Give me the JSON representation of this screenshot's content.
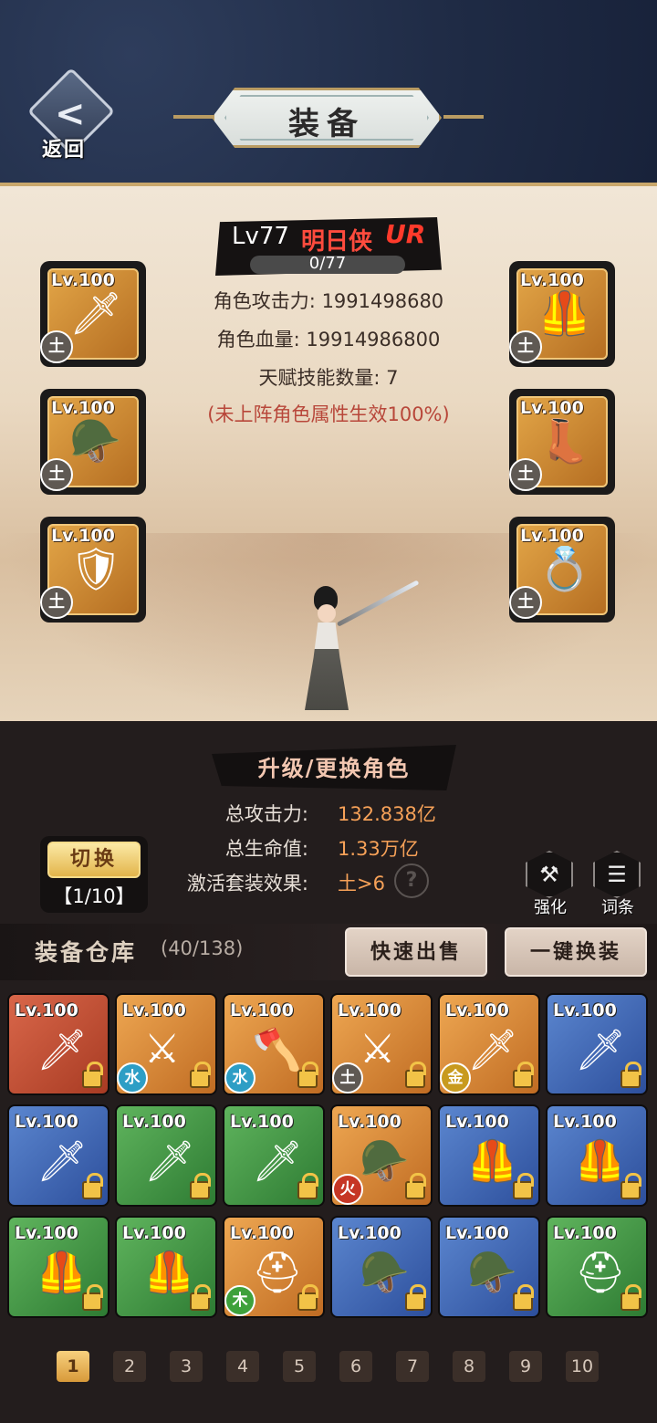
{
  "header": {
    "back_label": "返回",
    "back_glyph": "<",
    "title": "装备"
  },
  "hero": {
    "level": "Lv77",
    "name": "明日侠",
    "rank": "UR",
    "exp": "0/77",
    "attack_line": "角色攻击力: 1991498680",
    "hp_line": "角色血量: 19914986800",
    "talent_line": "天赋技能数量: 7",
    "note_line": "(未上阵角色属性生效100%)"
  },
  "equipped": [
    {
      "level": "Lv.100",
      "element": "土",
      "art": "🗡"
    },
    {
      "level": "Lv.100",
      "element": "土",
      "art": "🪖"
    },
    {
      "level": "Lv.100",
      "element": "土",
      "art": "🛡"
    },
    {
      "level": "Lv.100",
      "element": "土",
      "art": "🦺"
    },
    {
      "level": "Lv.100",
      "element": "土",
      "art": "👢"
    },
    {
      "level": "Lv.100",
      "element": "土",
      "art": "💍"
    }
  ],
  "summary": {
    "upgrade_label": "升级/更换角色",
    "total_attack_label": "总攻击力:",
    "total_attack_value": "132.838亿",
    "total_hp_label": "总生命值:",
    "total_hp_value": "1.33万亿",
    "set_label": "激活套装效果:",
    "set_value": "土>6",
    "help": "?"
  },
  "switch": {
    "label": "切换",
    "page": "【1/10】"
  },
  "side_buttons": {
    "enhance_label": "强化",
    "enhance_icon": "⚒",
    "affix_label": "词条",
    "affix_icon": "☰"
  },
  "warehouse": {
    "title": "装备仓库",
    "count": "(40/138)",
    "quick_sell": "快速出售",
    "one_key_equip": "一键换装"
  },
  "inventory": [
    {
      "level": "Lv.100",
      "rarity": "red",
      "art": "🗡",
      "element": ""
    },
    {
      "level": "Lv.100",
      "rarity": "orange",
      "art": "⚔",
      "element": "水"
    },
    {
      "level": "Lv.100",
      "rarity": "orange",
      "art": "🪓",
      "element": "水"
    },
    {
      "level": "Lv.100",
      "rarity": "orange",
      "art": "⚔",
      "element": "土"
    },
    {
      "level": "Lv.100",
      "rarity": "orange",
      "art": "🗡",
      "element": "金"
    },
    {
      "level": "Lv.100",
      "rarity": "blue",
      "art": "🗡",
      "element": ""
    },
    {
      "level": "Lv.100",
      "rarity": "blue",
      "art": "🗡",
      "element": ""
    },
    {
      "level": "Lv.100",
      "rarity": "green",
      "art": "🗡",
      "element": ""
    },
    {
      "level": "Lv.100",
      "rarity": "green",
      "art": "🗡",
      "element": ""
    },
    {
      "level": "Lv.100",
      "rarity": "orange",
      "art": "🪖",
      "element": "火"
    },
    {
      "level": "Lv.100",
      "rarity": "blue",
      "art": "🦺",
      "element": ""
    },
    {
      "level": "Lv.100",
      "rarity": "blue",
      "art": "🦺",
      "element": ""
    },
    {
      "level": "Lv.100",
      "rarity": "green",
      "art": "🦺",
      "element": ""
    },
    {
      "level": "Lv.100",
      "rarity": "green",
      "art": "🦺",
      "element": ""
    },
    {
      "level": "Lv.100",
      "rarity": "orange",
      "art": "⛑",
      "element": "木"
    },
    {
      "level": "Lv.100",
      "rarity": "blue",
      "art": "🪖",
      "element": ""
    },
    {
      "level": "Lv.100",
      "rarity": "blue",
      "art": "🪖",
      "element": ""
    },
    {
      "level": "Lv.100",
      "rarity": "green",
      "art": "⛑",
      "element": ""
    }
  ],
  "pager": {
    "pages": [
      "1",
      "2",
      "3",
      "4",
      "5",
      "6",
      "7",
      "8",
      "9",
      "10"
    ],
    "active": "1"
  },
  "colors": {
    "accent": "#c9a76b",
    "value_orange": "#f6a158",
    "rank_red": "#ff3a2b"
  }
}
